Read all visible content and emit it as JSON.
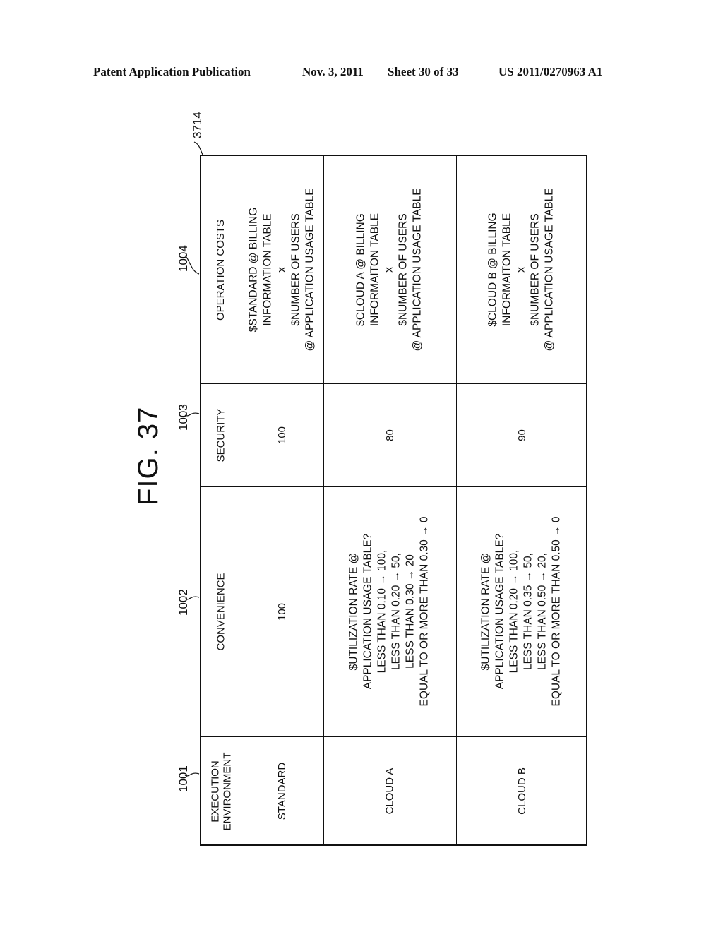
{
  "header": {
    "publication": "Patent Application Publication",
    "date": "Nov. 3, 2011",
    "sheet": "Sheet 30 of 33",
    "number": "US 2011/0270963 A1"
  },
  "figure": {
    "title": "FIG. 37",
    "table_ref": "3714",
    "column_refs": [
      "1001",
      "1002",
      "1003",
      "1004"
    ]
  },
  "table": {
    "headers": [
      {
        "id": "execution_environment",
        "lines": [
          "EXECUTION",
          "ENVIRONMENT"
        ]
      },
      {
        "id": "convenience",
        "lines": [
          "CONVENIENCE"
        ]
      },
      {
        "id": "security",
        "lines": [
          "SECURITY"
        ]
      },
      {
        "id": "operation_costs",
        "lines": [
          "OPERATION COSTS"
        ]
      }
    ],
    "rows": [
      {
        "environment": "STANDARD",
        "convenience": [
          "100"
        ],
        "security": "100",
        "operation_costs": [
          "$STANDARD @ BILLING",
          "INFORMATION TABLE",
          "x",
          "$NUMBER OF USERS",
          "@ APPLICATION USAGE TABLE"
        ]
      },
      {
        "environment": "CLOUD A",
        "convenience": [
          "$UTILIZATION RATE @",
          "APPLICATION USAGE TABLE?",
          "LESS THAN 0.10 → 100,",
          "LESS THAN 0.20 → 50,",
          "LESS THAN 0.30 → 20",
          "EQUAL TO OR MORE THAN 0.30 → 0"
        ],
        "security": "80",
        "operation_costs": [
          "$CLOUD A @ BILLING",
          "INFORMAITON TABLE",
          "x",
          "$NUMBER OF USERS",
          "@ APPLICATION USAGE TABLE"
        ]
      },
      {
        "environment": "CLOUD B",
        "convenience": [
          "$UTILIZATION RATE @",
          "APPLICATION USAGE TABLE?",
          "LESS THAN 0.20 → 100,",
          "LESS THAN 0.35 → 50,",
          "LESS THAN 0.50 → 20,",
          "EQUAL TO OR MORE THAN 0.50 → 0"
        ],
        "security": "90",
        "operation_costs": [
          "$CLOUD B @ BILLING",
          "INFORMAITON TABLE",
          "x",
          "$NUMBER OF USERS",
          "@ APPLICATION USAGE TABLE"
        ]
      }
    ]
  }
}
